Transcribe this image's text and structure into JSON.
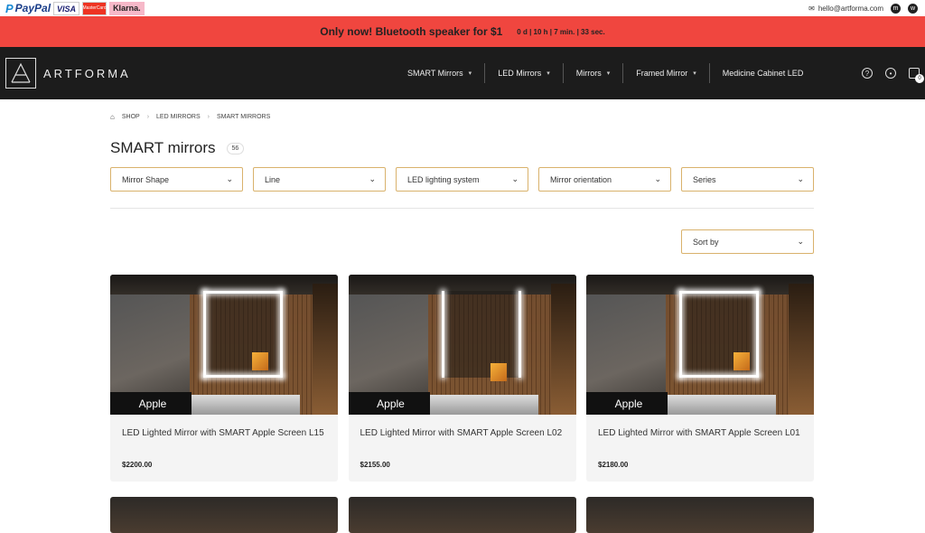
{
  "topbar": {
    "payments": [
      "PayPal",
      "VISA",
      "MasterCard",
      "Klarna."
    ],
    "email": "hello@artforma.com"
  },
  "promo": {
    "message": "Only now! Bluetooth speaker for $1",
    "timer": "0 d | 10 h | 7 min. | 33 sec."
  },
  "nav": {
    "logo": "ARTFORMA",
    "menu": [
      {
        "label": "SMART Mirrors",
        "dropdown": true
      },
      {
        "label": "LED Mirrors",
        "dropdown": true
      },
      {
        "label": "Mirrors",
        "dropdown": true
      },
      {
        "label": "Framed Mirror",
        "dropdown": true
      },
      {
        "label": "Medicine Cabinet LED",
        "dropdown": false
      }
    ],
    "cart_count": "0"
  },
  "breadcrumb": [
    "SHOP",
    "LED MIRRORS",
    "SMART MIRRORS"
  ],
  "page": {
    "title": "SMART mirrors",
    "count": "56"
  },
  "filters": [
    "Mirror Shape",
    "Line",
    "LED lighting system",
    "Mirror orientation",
    "Series"
  ],
  "sort": {
    "label": "Sort by"
  },
  "products": [
    {
      "title": "LED Lighted Mirror with SMART Apple Screen L15",
      "price": "$2200.00",
      "badge": "Apple"
    },
    {
      "title": "LED Lighted Mirror with SMART Apple Screen L02",
      "price": "$2155.00",
      "badge": "Apple"
    },
    {
      "title": "LED Lighted Mirror with SMART Apple Screen L01",
      "price": "$2180.00",
      "badge": "Apple"
    }
  ],
  "colors": {
    "promo_bg": "#f0463f",
    "nav_bg": "#1c1c1c",
    "filter_border": "#d9b26c"
  }
}
